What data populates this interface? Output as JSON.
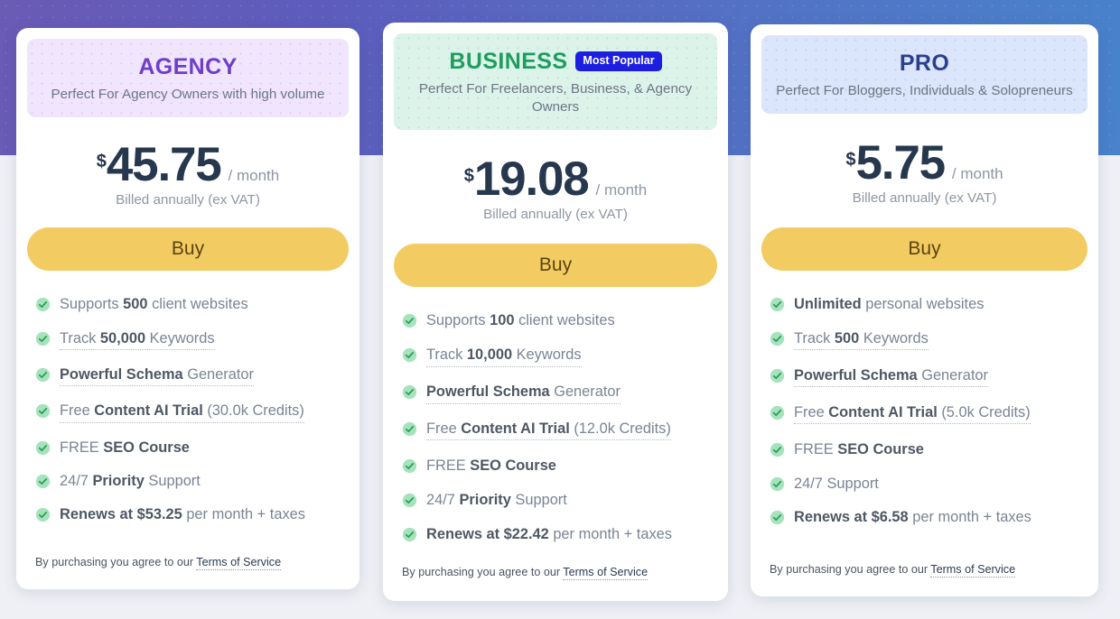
{
  "theme": {
    "gradient_start": "#6a5bb5",
    "gradient_end": "#4883cb",
    "page_background": "#eef0f5",
    "card_background": "#ffffff",
    "buy_button_color": "#f2cc63",
    "buy_button_text_color": "#5c4310",
    "check_circle_color": "#a6e3bd",
    "check_mark_color": "#2e9e5c",
    "badge_color": "#1e1ee0"
  },
  "footer_note": {
    "prefix": "By purchasing you agree to our ",
    "link_label": "Terms of Service"
  },
  "common": {
    "currency_symbol": "$",
    "period_label": "/ month",
    "billing_note": "Billed annually (ex VAT)",
    "buy_label": "Buy",
    "check_icon": "check-circle-icon"
  },
  "plans": [
    {
      "id": "agency",
      "title": "AGENCY",
      "title_color": "#6e3ec9",
      "header_background": "#f0e5fd",
      "badge": null,
      "tagline": "Perfect For Agency Owners with high volume",
      "price": "45.75",
      "currency_symbol": "$",
      "period_label": "/ month",
      "billing_note": "Billed annually (ex VAT)",
      "buy_label": "Buy",
      "features": [
        {
          "pre": "Supports ",
          "strong": "500",
          "post": " client websites",
          "tooltip": false
        },
        {
          "pre": "Track ",
          "strong": "50,000",
          "post": " Keywords",
          "tooltip": true
        },
        {
          "pre": "",
          "strong": "Powerful Schema",
          "post": " Generator",
          "tooltip": true
        },
        {
          "pre": "Free ",
          "strong": "Content AI Trial",
          "post": " (30.0k Credits)",
          "tooltip": true
        },
        {
          "pre": "FREE ",
          "strong": "SEO Course",
          "post": "",
          "tooltip": false
        },
        {
          "pre": "24/7 ",
          "strong": "Priority",
          "post": " Support",
          "tooltip": false
        },
        {
          "pre": "",
          "strong": "Renews at $53.25",
          "post": " per month + taxes",
          "tooltip": false
        }
      ]
    },
    {
      "id": "business",
      "title": "BUSINESS",
      "title_color": "#1f9d5f",
      "header_background": "#dcf3ea",
      "badge": "Most Popular",
      "tagline": "Perfect For Freelancers, Business, & Agency Owners",
      "price": "19.08",
      "currency_symbol": "$",
      "period_label": "/ month",
      "billing_note": "Billed annually (ex VAT)",
      "buy_label": "Buy",
      "features": [
        {
          "pre": "Supports ",
          "strong": "100",
          "post": " client websites",
          "tooltip": false
        },
        {
          "pre": "Track ",
          "strong": "10,000",
          "post": " Keywords",
          "tooltip": true
        },
        {
          "pre": "",
          "strong": "Powerful Schema",
          "post": " Generator",
          "tooltip": true
        },
        {
          "pre": "Free ",
          "strong": "Content AI Trial",
          "post": " (12.0k Credits)",
          "tooltip": true
        },
        {
          "pre": "FREE ",
          "strong": "SEO Course",
          "post": "",
          "tooltip": false
        },
        {
          "pre": "24/7 ",
          "strong": "Priority",
          "post": " Support",
          "tooltip": false
        },
        {
          "pre": "",
          "strong": "Renews at $22.42",
          "post": " per month + taxes",
          "tooltip": false
        }
      ]
    },
    {
      "id": "pro",
      "title": "PRO",
      "title_color": "#2b3f8c",
      "header_background": "#dbe5fb",
      "badge": null,
      "tagline": "Perfect For Bloggers, Individuals & Solopreneurs",
      "price": "5.75",
      "currency_symbol": "$",
      "period_label": "/ month",
      "billing_note": "Billed annually (ex VAT)",
      "buy_label": "Buy",
      "features": [
        {
          "pre": "",
          "strong": "Unlimited",
          "post": " personal websites",
          "tooltip": false
        },
        {
          "pre": "Track ",
          "strong": "500",
          "post": " Keywords",
          "tooltip": true
        },
        {
          "pre": "",
          "strong": "Powerful Schema",
          "post": " Generator",
          "tooltip": true
        },
        {
          "pre": "Free ",
          "strong": "Content AI Trial",
          "post": " (5.0k Credits)",
          "tooltip": true
        },
        {
          "pre": "FREE ",
          "strong": "SEO Course",
          "post": "",
          "tooltip": false
        },
        {
          "pre": "24/7 Support",
          "strong": "",
          "post": "",
          "tooltip": false
        },
        {
          "pre": "",
          "strong": "Renews at $6.58",
          "post": " per month + taxes",
          "tooltip": false
        }
      ]
    }
  ]
}
